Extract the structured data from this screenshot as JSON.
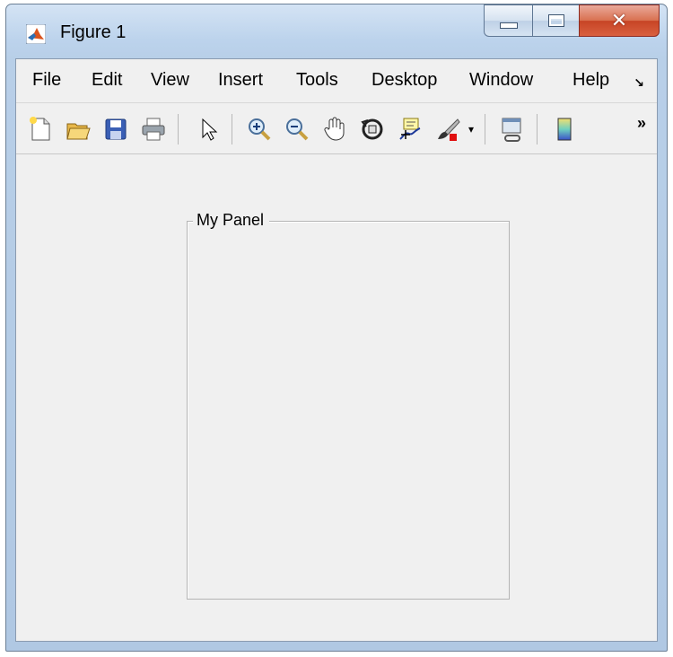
{
  "window": {
    "title": "Figure 1"
  },
  "menu": [
    "File",
    "Edit",
    "View",
    "Insert",
    "Tools",
    "Desktop",
    "Window",
    "Help"
  ],
  "toolbar": {
    "buttons": [
      "new-figure-icon",
      "open-file-icon",
      "save-icon",
      "print-icon",
      "pointer-icon",
      "zoom-in-icon",
      "zoom-out-icon",
      "pan-hand-icon",
      "rotate-3d-icon",
      "data-cursor-icon",
      "brush-icon",
      "link-plot-icon",
      "colorbar-icon"
    ],
    "more_glyph": "»"
  },
  "panel": {
    "title": "My Panel"
  }
}
